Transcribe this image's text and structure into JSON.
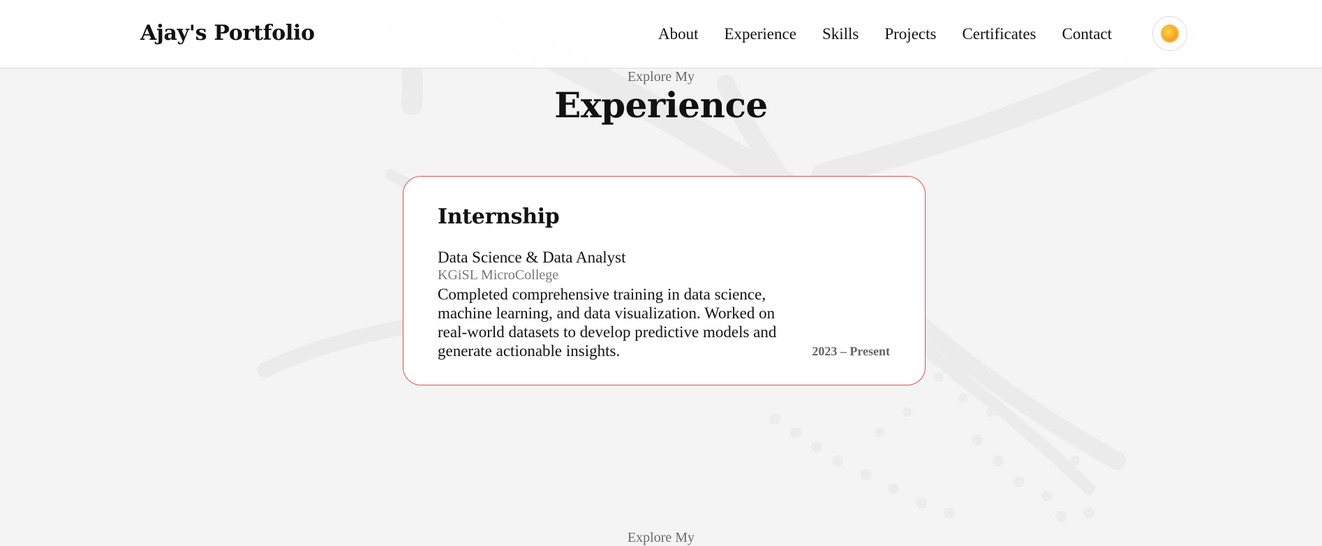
{
  "header": {
    "logo": "Ajay's Portfolio",
    "nav": [
      "About",
      "Experience",
      "Skills",
      "Projects",
      "Certificates",
      "Contact"
    ],
    "theme_toggle_icon": "sun-icon"
  },
  "section": {
    "subtitle": "Explore My",
    "title": "Experience"
  },
  "experience": {
    "title": "Internship",
    "role": "Data Science & Data Analyst",
    "organization": "KGiSL MicroCollege",
    "description": "Completed comprehensive training in data science, machine learning, and data visualization. Worked on real-world datasets to develop predictive models and generate actionable insights.",
    "period": "2023 – Present"
  },
  "next_section": {
    "subtitle": "Explore My"
  },
  "colors": {
    "background": "#f4f4f4",
    "card_border": "#d9534f",
    "text": "#111111",
    "muted": "#6a6a6a"
  }
}
